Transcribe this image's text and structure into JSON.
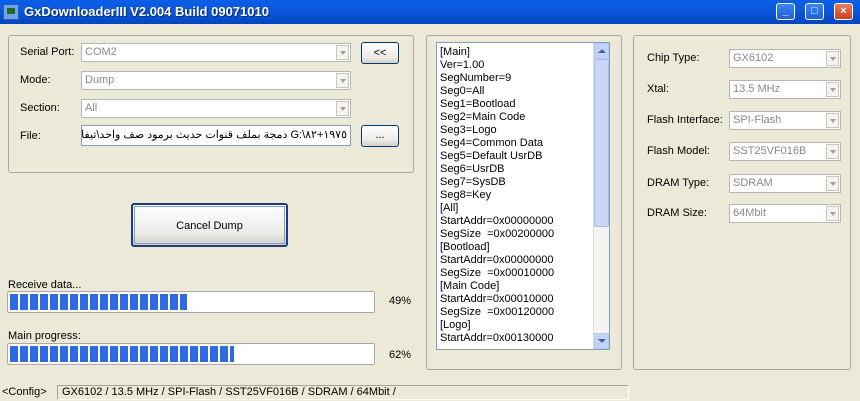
{
  "window": {
    "title": "GxDownloaderIII V2.004 Build 09071010",
    "buttons": {
      "minimize": "_",
      "maximize": "□",
      "close": "×"
    }
  },
  "config": {
    "serial_port": {
      "label": "Serial Port:",
      "value": "COM2"
    },
    "mode": {
      "label": "Mode:",
      "value": "Dump"
    },
    "section": {
      "label": "Section:",
      "value": "All"
    },
    "file": {
      "label": "File:",
      "value": "G:\\۸۲+۱۹۷٥ دمجة بملف قنوات حديث برمود صف واحد\\تيفا"
    },
    "collapse_button": "<<",
    "browse_button": "..."
  },
  "actions": {
    "cancel_dump": "Cancel Dump"
  },
  "progress": {
    "receive": {
      "label": "Receive data...",
      "percent": 49,
      "percent_text": "49%"
    },
    "main": {
      "label": "Main progress:",
      "percent": 62,
      "percent_text": "62%"
    }
  },
  "log_lines": [
    "[Main]",
    "Ver=1.00",
    "SegNumber=9",
    "Seg0=All",
    "Seg1=Bootload",
    "Seg2=Main Code",
    "Seg3=Logo",
    "Seg4=Common Data",
    "Seg5=Default UsrDB",
    "Seg6=UsrDB",
    "Seg7=SysDB",
    "Seg8=Key",
    "[All]",
    "StartAddr=0x00000000",
    "SegSize  =0x00200000",
    "[Bootload]",
    "StartAddr=0x00000000",
    "SegSize  =0x00010000",
    "[Main Code]",
    "StartAddr=0x00010000",
    "SegSize  =0x00120000",
    "[Logo]",
    "StartAddr=0x00130000"
  ],
  "chip": {
    "chip_type": {
      "label": "Chip Type:",
      "value": "GX6102"
    },
    "xtal": {
      "label": "Xtal:",
      "value": "13.5 MHz"
    },
    "flash_interface": {
      "label": "Flash Interface:",
      "value": "SPI-Flash"
    },
    "flash_model": {
      "label": "Flash Model:",
      "value": "SST25VF016B"
    },
    "dram_type": {
      "label": "DRAM Type:",
      "value": "SDRAM"
    },
    "dram_size": {
      "label": "DRAM Size:",
      "value": "64Mbit"
    }
  },
  "statusbar": {
    "tag": "<Config>",
    "summary": "GX6102 / 13.5 MHz / SPI-Flash / SST25VF016B / SDRAM / 64Mbit /"
  },
  "colors": {
    "titlebar": "#0A5FE8",
    "progress_fill": "#2F6BE0",
    "window_bg": "#ECE9D8"
  }
}
